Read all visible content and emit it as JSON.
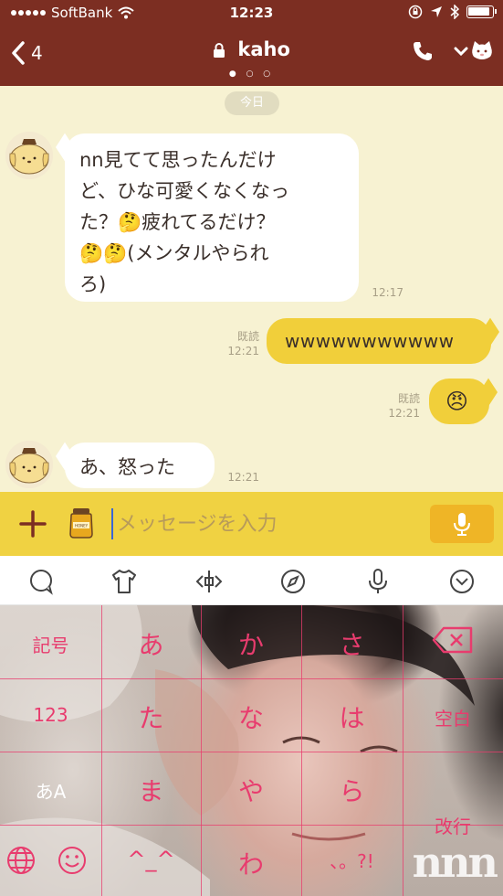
{
  "status_bar": {
    "carrier": "SoftBank",
    "time": "12:23"
  },
  "header": {
    "back_count": "4",
    "title": "kaho",
    "pager": "● ○ ○"
  },
  "chat": {
    "date_label": "今日",
    "messages": [
      {
        "sender": "kaho",
        "lines": [
          "nn見てて思ったんだけ",
          "ど、ひな可愛くなくなっ",
          "た？🤔疲れてるだけ？",
          "🤔🤔(メンタルやられ",
          "ろ)"
        ],
        "time": "12:17"
      },
      {
        "sender": "me",
        "text": "wwwwwwwwwww",
        "read": "既読",
        "time": "12:21"
      },
      {
        "sender": "me",
        "text": "😠",
        "read": "既読",
        "time": "12:21"
      },
      {
        "sender": "kaho",
        "text": "あ、怒った",
        "time": "12:21"
      }
    ]
  },
  "input_bar": {
    "placeholder": "メッセージを入力",
    "honey_label": "HONEY"
  },
  "keyboard": {
    "keys": {
      "r1c1": "記号",
      "r1c2": "あ",
      "r1c3": "か",
      "r1c4": "さ",
      "r2c1": "123",
      "r2c2": "た",
      "r2c3": "な",
      "r2c4": "は",
      "r2c5": "空白",
      "r3c1": "あA",
      "r3c2": "ま",
      "r3c3": "や",
      "r3c4": "ら",
      "r3c5": "改行",
      "r4c3": "^_^",
      "r4c4": "わ",
      "r4c5": "、。?!"
    },
    "key_color": "#e83c6e"
  },
  "watermark": "nnn",
  "colors": {
    "header_bg": "#7c2e22",
    "chat_bg": "#f7f2d2",
    "my_bubble": "#f1cf3a",
    "input_bar": "#f0d242",
    "mic_button": "#efb526"
  }
}
